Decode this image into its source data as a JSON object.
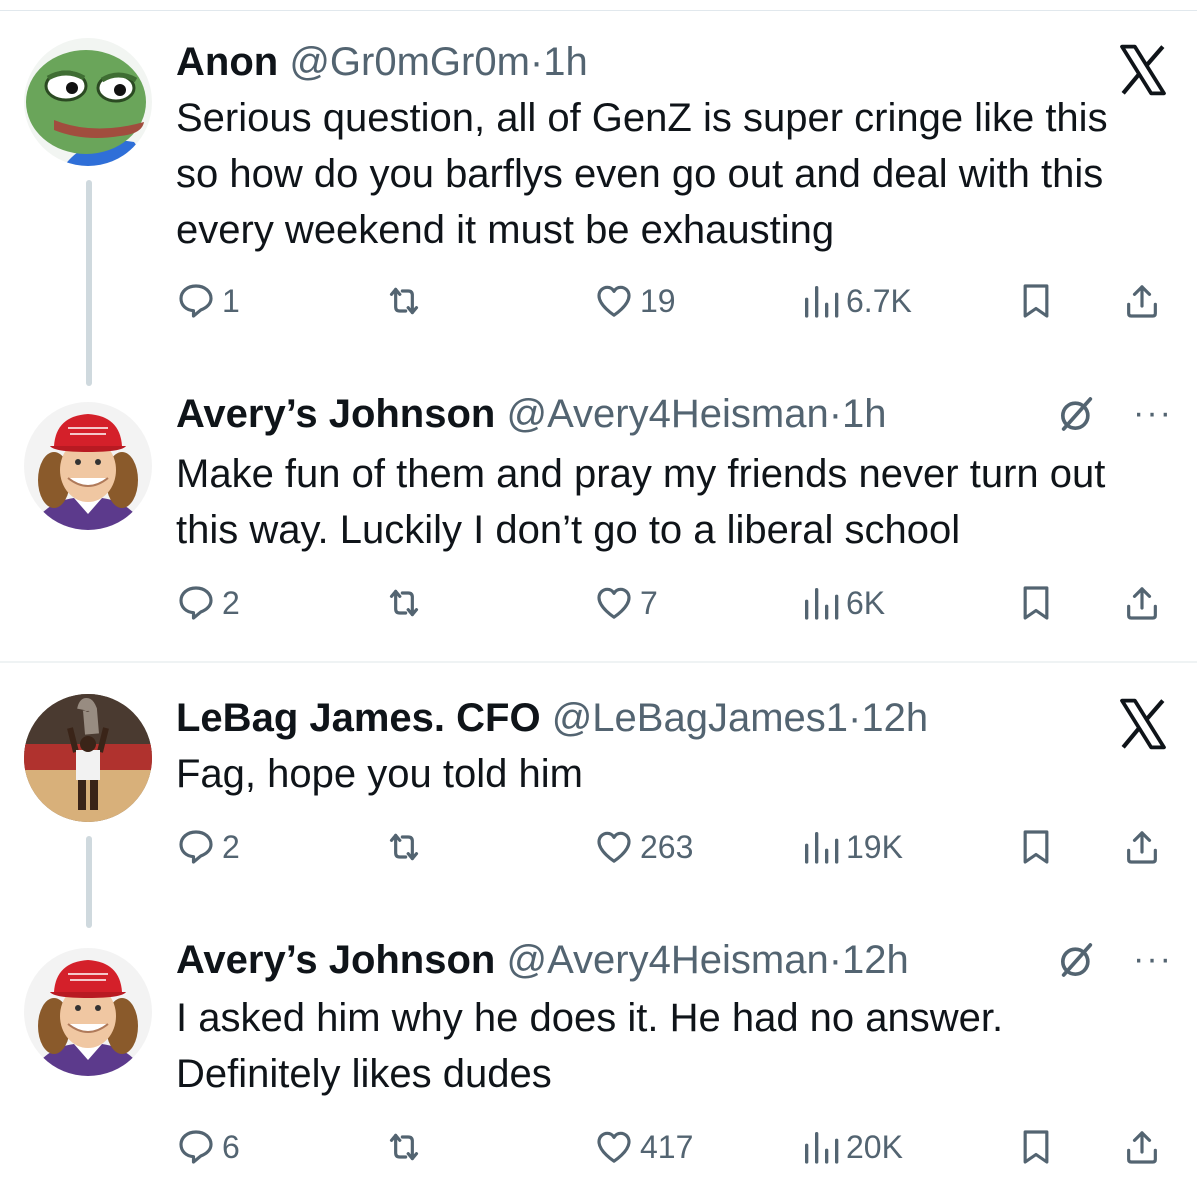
{
  "tweets": [
    {
      "name": "Anon",
      "handle": "@Gr0mGr0m",
      "dot": "·",
      "time": "1h",
      "text": "Serious question, all of GenZ is super cringe like this so how do you barflys even go out and deal with this every weekend it must be exhausting",
      "replies": "1",
      "likes": "19",
      "views": "6.7K",
      "corner_icon": "x-logo-icon"
    },
    {
      "name": "Avery’s Johnson",
      "handle": "@Avery4Heisman",
      "dot": "·",
      "time": "1h",
      "text": "Make fun of them and pray my friends never turn out this way. Luckily I don’t go to a liberal school",
      "replies": "2",
      "likes": "7",
      "views": "6K",
      "corner_icon": "grok-icon",
      "more": "···"
    },
    {
      "name": "LeBag James. CFO",
      "handle": "@LeBagJames1",
      "dot": "·",
      "time": "12h",
      "text": "Fag, hope you told him",
      "replies": "2",
      "likes": "263",
      "views": "19K",
      "corner_icon": "x-logo-icon"
    },
    {
      "name": "Avery’s Johnson",
      "handle": "@Avery4Heisman",
      "dot": "·",
      "time": "12h",
      "text": "I asked him why he does it. He had no answer. Definitely likes dudes",
      "replies": "6",
      "likes": "417",
      "views": "20K",
      "corner_icon": "grok-icon",
      "more": "···"
    }
  ],
  "colors": {
    "text": "#0f1419",
    "secondary": "#536471",
    "thread_line": "#cfd9de",
    "divider": "#eff3f4"
  }
}
